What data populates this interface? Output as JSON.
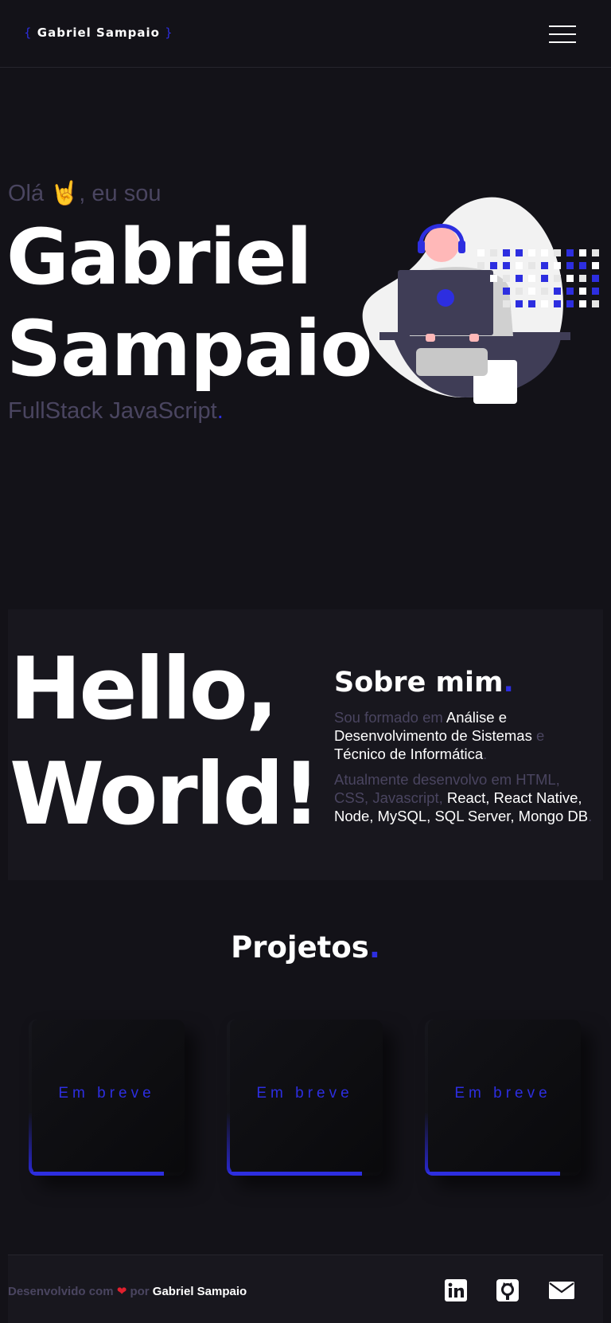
{
  "header": {
    "brand_open": "{",
    "brand_name": "Gabriel Sampaio",
    "brand_close": "}"
  },
  "hero": {
    "greeting_pre": "Olá ",
    "greeting_emoji": "🤘",
    "greeting_post": ", eu sou",
    "name_line1": "Gabriel",
    "name_line2": "Sampaio",
    "role": "FullStack JavaScript",
    "role_dot": "."
  },
  "about": {
    "hello_line1": "Hello,",
    "hello_line2": "World!",
    "title": "Sobre mim",
    "title_dot": ".",
    "p1_a": "Sou formado em ",
    "p1_b": "Análise e Desenvolvimento de Sistemas",
    "p1_c": " e ",
    "p1_d": "Técnico de Informática",
    "p1_e": ".",
    "p2_a": "Atualmente desenvolvo em HTML, CSS, Javascript, ",
    "p2_b": "React, React Native, Node, MySQL, SQL Server, Mongo DB",
    "p2_c": "."
  },
  "projects": {
    "title": "Projetos",
    "title_dot": ".",
    "cards": [
      {
        "label": "Em breve"
      },
      {
        "label": "Em breve"
      },
      {
        "label": "Em breve"
      }
    ]
  },
  "footer": {
    "credit_pre": "Desenvolvido com ",
    "credit_heart": "❤",
    "credit_mid": " por ",
    "credit_author": "Gabriel Sampaio",
    "social": [
      {
        "icon": "linkedin-icon"
      },
      {
        "icon": "github-icon"
      },
      {
        "icon": "email-icon"
      }
    ]
  },
  "colors": {
    "background": "#131218",
    "accent": "#2d2ee0",
    "muted_text": "#4a4560",
    "panel": "#18171e"
  }
}
